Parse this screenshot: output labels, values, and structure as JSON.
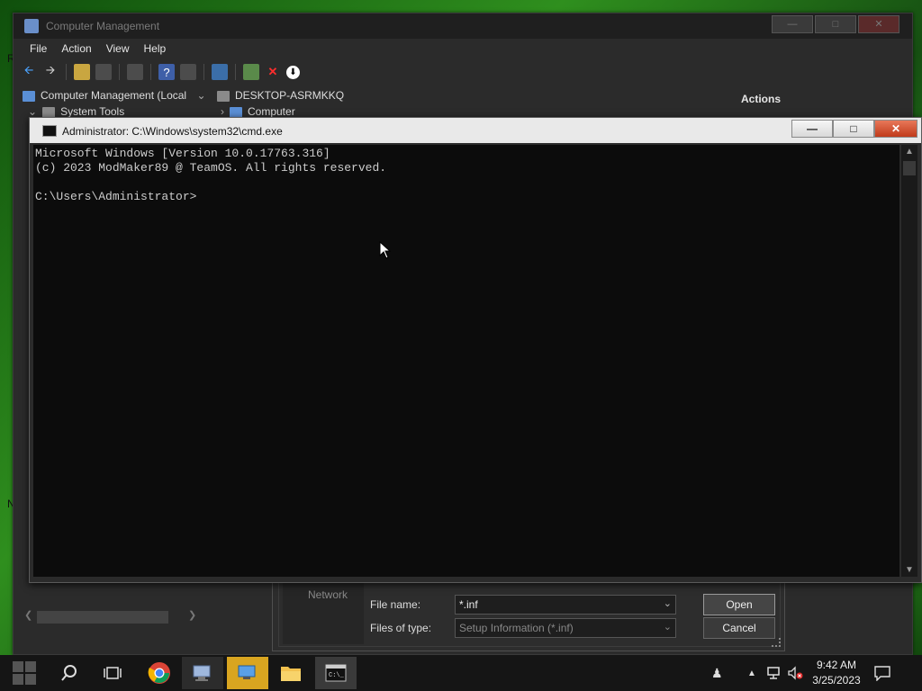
{
  "desktop": {
    "side_labels": [
      "R",
      "N"
    ]
  },
  "computer_management": {
    "title": "Computer Management",
    "menu": [
      "File",
      "Action",
      "View",
      "Help"
    ],
    "tree": {
      "root": "Computer Management (Local",
      "child": "System Tools"
    },
    "middle": {
      "machine": "DESKTOP-ASRMKKQ",
      "item": "Computer"
    },
    "actions_header": "Actions"
  },
  "file_dialog": {
    "network_label": "Network",
    "file_name_label": "File name:",
    "file_name_value": "*.inf",
    "file_type_label": "Files of type:",
    "file_type_value": "Setup Information (*.inf)",
    "open_button": "Open",
    "cancel_button": "Cancel"
  },
  "cmd": {
    "title": "Administrator: C:\\Windows\\system32\\cmd.exe",
    "lines": [
      "Microsoft Windows [Version 10.0.17763.316]",
      "(c) 2023 ModMaker89 @ TeamOS. All rights reserved.",
      "",
      "C:\\Users\\Administrator>"
    ]
  },
  "taskbar": {
    "time": "9:42 AM",
    "date": "3/25/2023"
  },
  "colors": {
    "console_bg": "#0c0c0c",
    "console_fg": "#cccccc",
    "close_red": "#c03a1a"
  }
}
